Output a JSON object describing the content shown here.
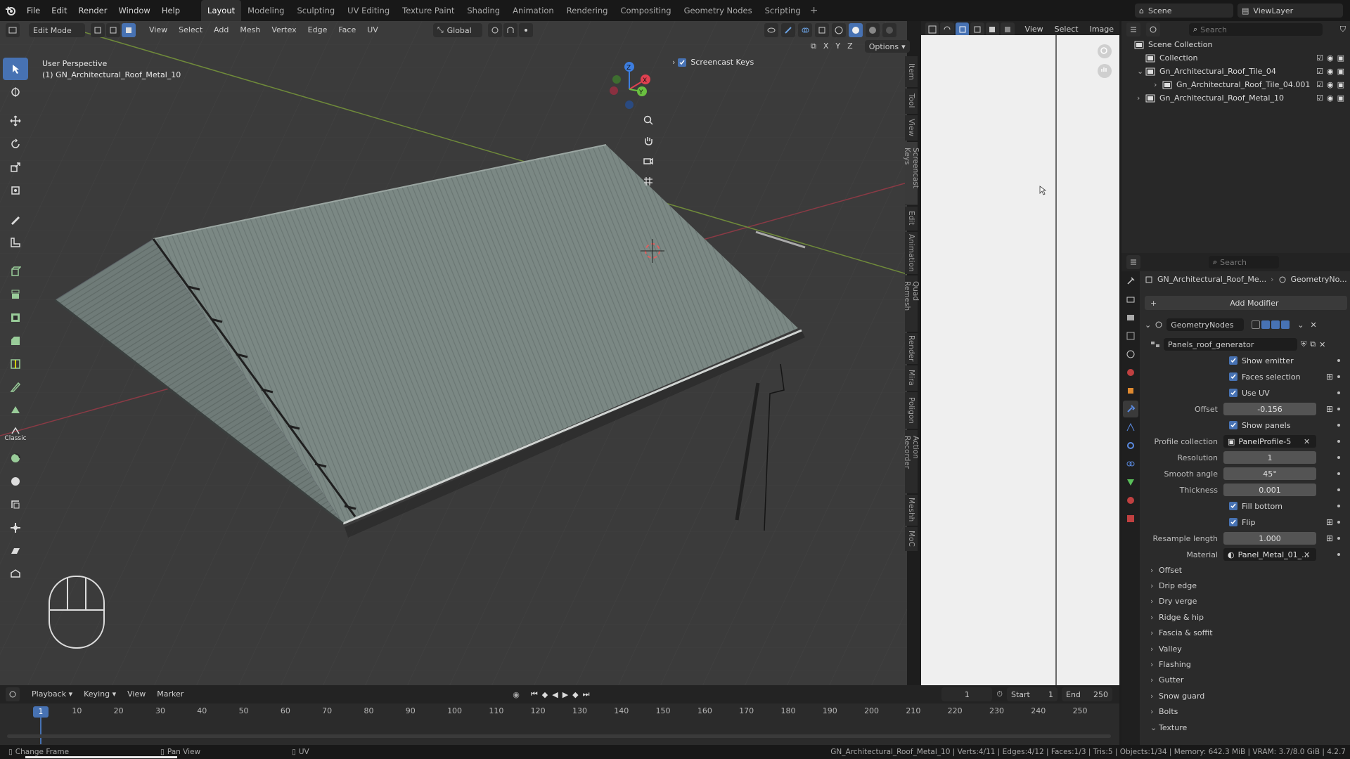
{
  "menu": [
    "File",
    "Edit",
    "Render",
    "Window",
    "Help"
  ],
  "workspaces": [
    "Layout",
    "Modeling",
    "Sculpting",
    "UV Editing",
    "Texture Paint",
    "Shading",
    "Animation",
    "Rendering",
    "Compositing",
    "Geometry Nodes",
    "Scripting"
  ],
  "scene": "Scene",
  "view_layer": "ViewLayer",
  "viewport": {
    "mode": "Edit Mode",
    "menus": [
      "View",
      "Select",
      "Add",
      "Mesh",
      "Vertex",
      "Edge",
      "Face",
      "UV"
    ],
    "orientation": "Global",
    "options": "Options",
    "axes": [
      "X",
      "Y",
      "Z"
    ],
    "perspective": "User Perspective",
    "object_label": "(1) GN_Architectural_Roof_Metal_10",
    "screencast_keys": "Screencast Keys",
    "toolbar_label": "Classic"
  },
  "side_tabs": [
    "Item",
    "Tool",
    "View",
    "Screencast Keys",
    "Edit",
    "Animation",
    "Quad Remesh",
    "Render",
    "Mira",
    "Poligon",
    "Action Recorder",
    "Meshh",
    "MoC"
  ],
  "image_editor": {
    "menus": [
      "View",
      "Select",
      "Image"
    ]
  },
  "outliner": {
    "search": "Search",
    "rows": [
      {
        "label": "Scene Collection",
        "indent": 0
      },
      {
        "label": "Collection",
        "indent": 1
      },
      {
        "label": "Gn_Architectural_Roof_Tile_04",
        "indent": 1
      },
      {
        "label": "Gn_Architectural_Roof_Tile_04.001",
        "indent": 2
      },
      {
        "label": "Gn_Architectural_Roof_Metal_10",
        "indent": 1
      }
    ]
  },
  "properties": {
    "search": "Search",
    "breadcrumb_object": "GN_Architectural_Roof_Me...",
    "breadcrumb_modifier": "GeometryNo...",
    "add_modifier": "Add Modifier",
    "modifier_name": "GeometryNodes",
    "node_group": "Panels_roof_generator",
    "fields": [
      {
        "type": "check",
        "label": "Show emitter"
      },
      {
        "type": "check",
        "label": "Faces selection"
      },
      {
        "type": "check",
        "label": "Use UV"
      },
      {
        "type": "value",
        "label": "Offset",
        "value": "-0.156"
      },
      {
        "type": "check",
        "label": "Show panels"
      },
      {
        "type": "object",
        "label": "Profile collection",
        "value": "PanelProfile-5"
      },
      {
        "type": "value",
        "label": "Resolution",
        "value": "1"
      },
      {
        "type": "value",
        "label": "Smooth angle",
        "value": "45°"
      },
      {
        "type": "value",
        "label": "Thickness",
        "value": "0.001"
      },
      {
        "type": "check",
        "label": "Fill bottom"
      },
      {
        "type": "check",
        "label": "Flip"
      },
      {
        "type": "value",
        "label": "Resample length",
        "value": "1.000"
      },
      {
        "type": "object",
        "label": "Material",
        "value": "Panel_Metal_01_..."
      }
    ],
    "panels": [
      "Offset",
      "Drip edge",
      "Dry verge",
      "Ridge & hip",
      "Fascia & soffit",
      "Valley",
      "Flashing",
      "Gutter",
      "Snow guard",
      "Bolts",
      "Texture"
    ]
  },
  "timeline": {
    "menus": [
      "Playback",
      "Keying",
      "View",
      "Marker"
    ],
    "current_frame": "1",
    "start_label": "Start",
    "start": "1",
    "end_label": "End",
    "end": "250",
    "ruler": [
      "1",
      "10",
      "20",
      "30",
      "40",
      "50",
      "60",
      "70",
      "80",
      "90",
      "100",
      "110",
      "120",
      "130",
      "140",
      "150",
      "160",
      "170",
      "180",
      "190",
      "200",
      "210",
      "220",
      "230",
      "240",
      "250"
    ]
  },
  "status": {
    "left": [
      "Change Frame",
      "Pan View",
      "UV"
    ],
    "right": "GN_Architectural_Roof_Metal_10 | Verts:4/11 | Edges:4/12 | Faces:1/3 | Tris:5 | Objects:1/34 | Memory: 642.3 MiB | VRAM: 3.7/8.0 GiB | 4.2.7"
  },
  "colors": {
    "accent": "#4772b3",
    "roof": "#7a8682",
    "bg": "#3d3d3d"
  }
}
